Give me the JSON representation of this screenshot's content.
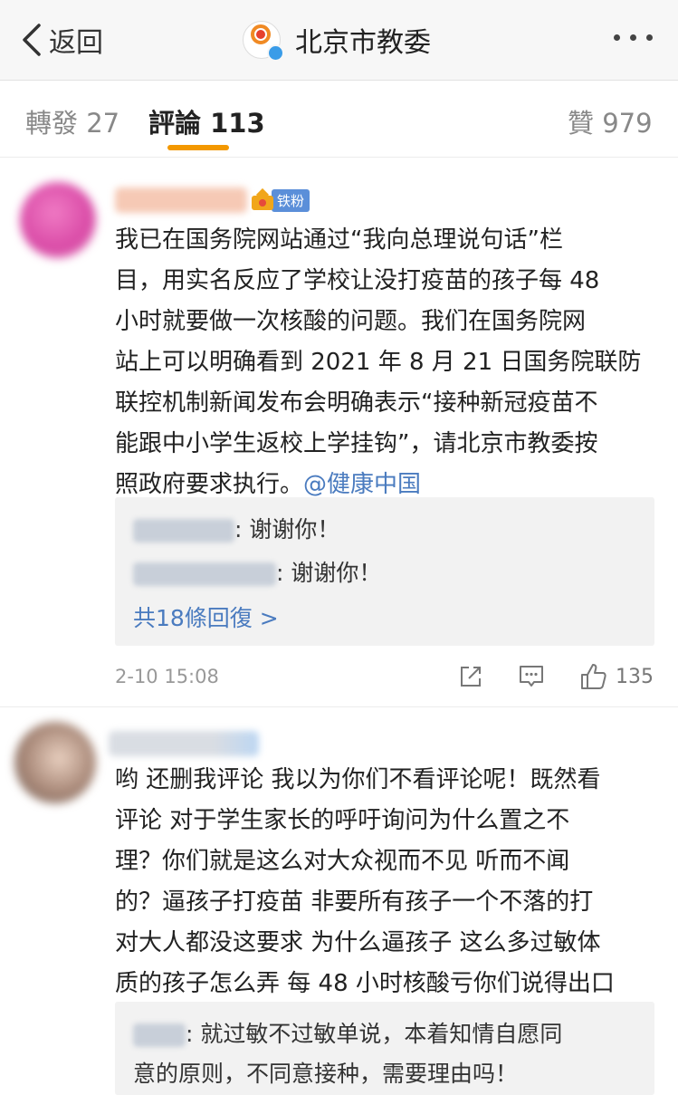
{
  "nav": {
    "back_label": "返回",
    "title": "北京市教委",
    "more_icon": "more-dots-icon"
  },
  "tabs": [
    {
      "label": "轉發 27"
    },
    {
      "label": "評論 113"
    },
    {
      "label": "贊 979"
    }
  ],
  "comments": [
    {
      "badge": "铁粉",
      "lines": [
        "我已在国务院网站通过“我向总理说句话”栏",
        "目，用实名反应了学校让没打疫苗的孩子每 48",
        "小时就要做一次核酸的问题。我们在国务院网",
        "站上可以明确看到 2021 年 8 月 21 日国务院联防",
        "联控机制新闻发布会明确表示“接种新冠疫苗不",
        "能跟中小学生返校上学挂钩”，请北京市教委按",
        "照政府要求执行。"
      ],
      "mention": "@健康中国",
      "replies": [
        {
          "text": ": 谢谢你！"
        },
        {
          "text": ": 谢谢你！"
        }
      ],
      "more_replies": "共18條回復 >",
      "time": "2-10 15:08",
      "like_count": "135"
    },
    {
      "lines": [
        "哟 还删我评论 我以为你们不看评论呢！既然看",
        "评论 对于学生家长的呼吁询问为什么置之不",
        "理？你们就是这么对大众视而不见 听而不闻",
        "的？逼孩子打疫苗 非要所有孩子一个不落的打",
        "对大人都没这要求 为什么逼孩子 这么多过敏体",
        "质的孩子怎么弄 每 48 小时核酸亏你们说得出口"
      ],
      "replies": [
        {
          "text": ": 就过敏不过敏单说，本着知情自愿同"
        },
        {
          "text": "意的原则，不同意接种，需要理由吗！"
        }
      ]
    }
  ],
  "colors": {
    "accent": "#f39800",
    "link": "#4a7bbf",
    "badge": "#5b8fd9"
  }
}
